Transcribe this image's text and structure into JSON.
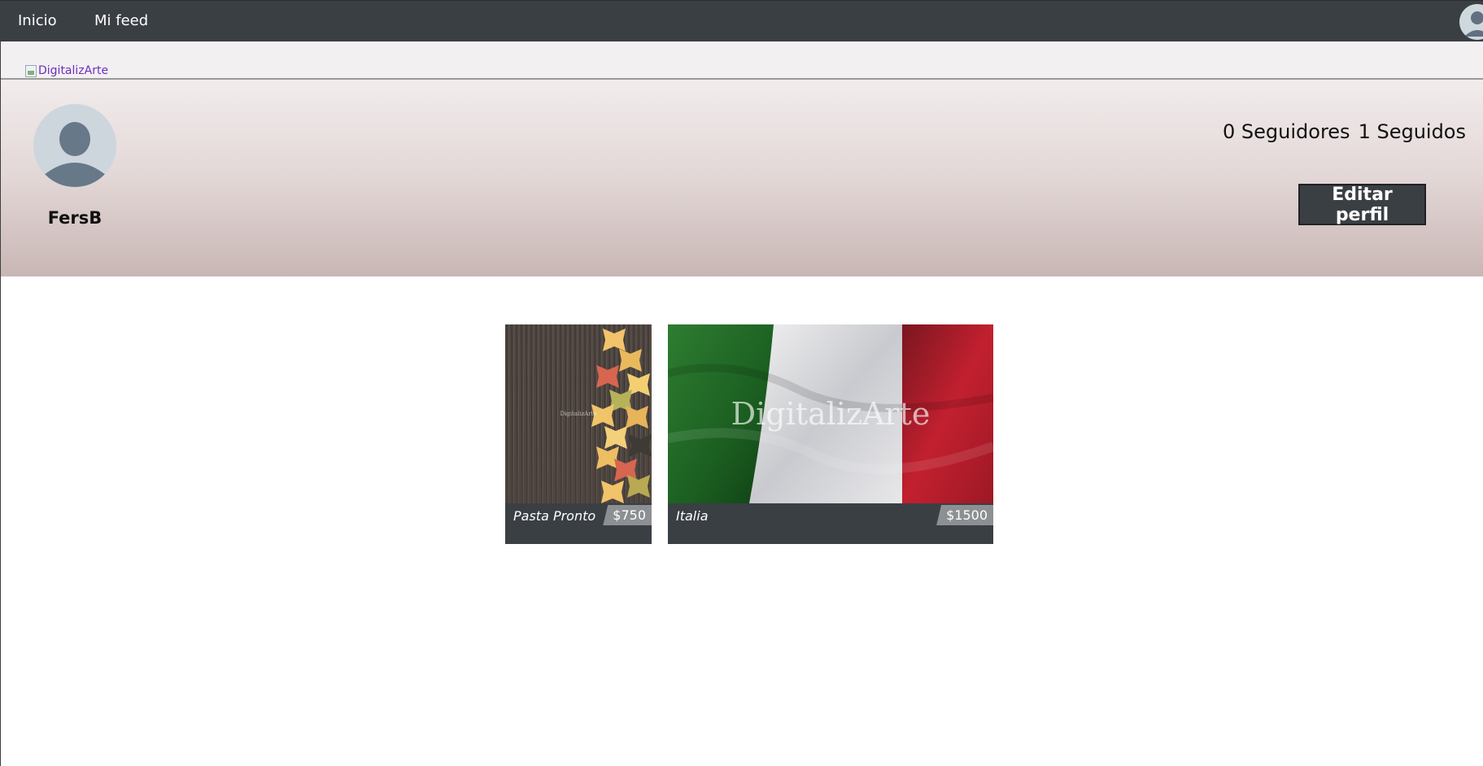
{
  "nav": {
    "links": [
      {
        "label": "Inicio"
      },
      {
        "label": "Mi feed"
      }
    ],
    "avatar_icon": "user-avatar-icon"
  },
  "logo": {
    "alt": "DigitalizArte",
    "icon": "broken-image-icon"
  },
  "profile": {
    "username": "FersB",
    "followers_label": "0 Seguidores",
    "following_label": "1 Seguidos",
    "edit_button": "Editar perfil",
    "avatar_icon": "default-avatar-icon"
  },
  "works": [
    {
      "title": "Pasta Pronto",
      "price": "$750",
      "watermark": "DigitalizArte"
    },
    {
      "title": "Italia",
      "price": "$1500",
      "watermark": "DigitalizArte"
    }
  ],
  "colors": {
    "navbar": "#3a3f44",
    "button": "#3a3f44",
    "price_tag": "#8d9093",
    "logo_link": "#6b2fbf"
  }
}
